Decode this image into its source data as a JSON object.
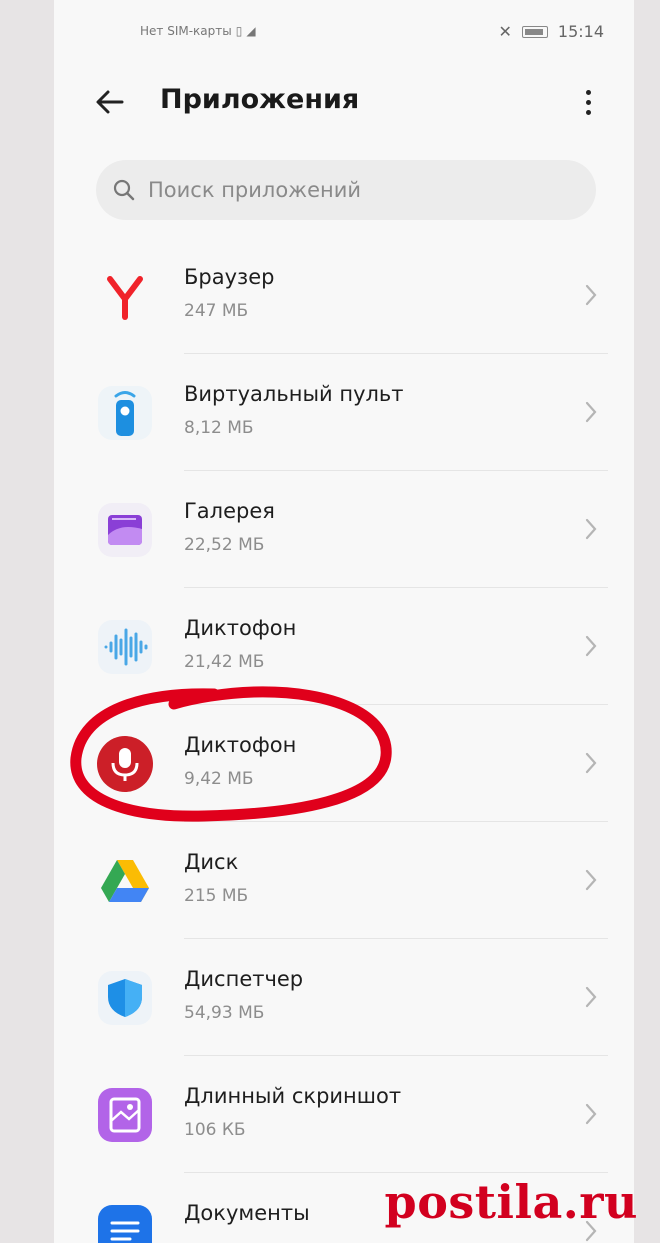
{
  "status_bar": {
    "carrier": "Нет SIM-карты",
    "time": "15:14"
  },
  "header": {
    "title": "Приложения"
  },
  "search": {
    "placeholder": "Поиск приложений"
  },
  "apps": [
    {
      "name": "Браузер",
      "size": "247 МБ",
      "icon": "yandex-browser-icon"
    },
    {
      "name": "Виртуальный пульт",
      "size": "8,12 МБ",
      "icon": "virtual-remote-icon"
    },
    {
      "name": "Галерея",
      "size": "22,52 МБ",
      "icon": "gallery-icon"
    },
    {
      "name": "Диктофон",
      "size": "21,42 МБ",
      "icon": "sound-wave-icon"
    },
    {
      "name": "Диктофон",
      "size": "9,42 МБ",
      "icon": "red-microphone-icon"
    },
    {
      "name": "Диск",
      "size": "215 МБ",
      "icon": "google-drive-icon"
    },
    {
      "name": "Диспетчер",
      "size": "54,93 МБ",
      "icon": "shield-icon"
    },
    {
      "name": "Длинный скриншот",
      "size": "106 КБ",
      "icon": "long-screenshot-icon"
    },
    {
      "name": "Документы",
      "size": "",
      "icon": "docs-icon"
    }
  ],
  "watermark": "postila.ru",
  "colors": {
    "highlight": "#e0001b",
    "accent_blue": "#1e73e8"
  }
}
